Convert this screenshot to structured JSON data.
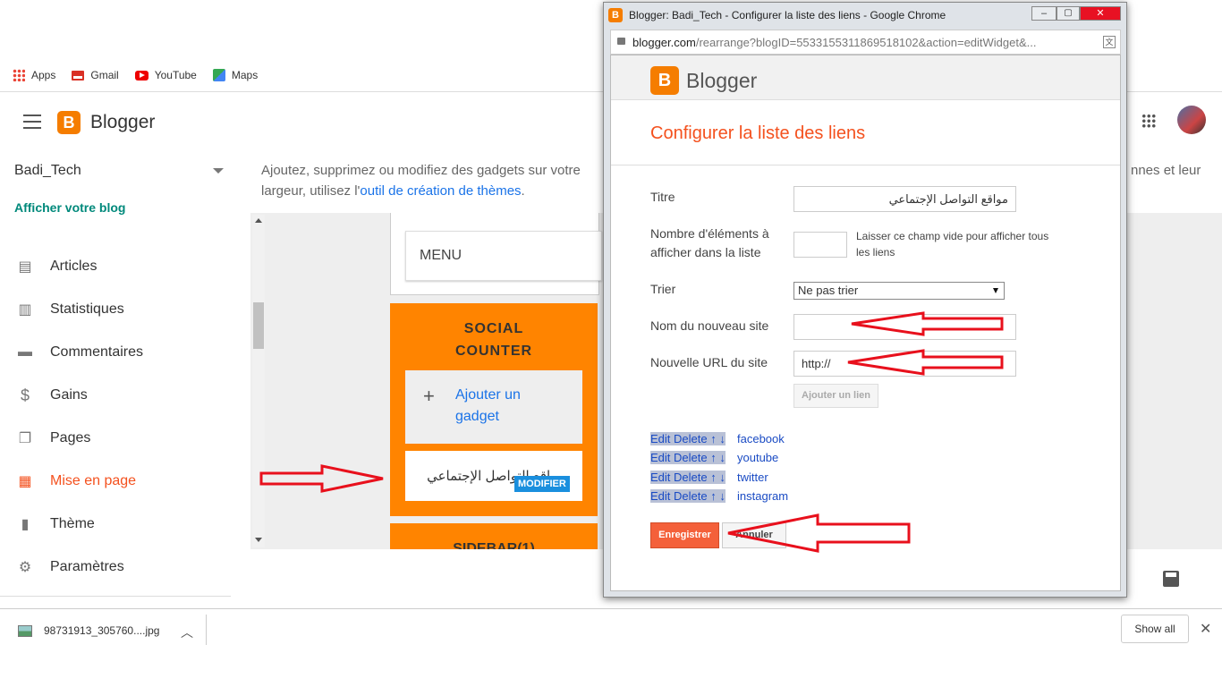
{
  "bookmarks": [
    {
      "label": "Apps",
      "icon": "apps-grid-icon"
    },
    {
      "label": "Gmail",
      "icon": "gmail-icon"
    },
    {
      "label": "YouTube",
      "icon": "youtube-icon"
    },
    {
      "label": "Maps",
      "icon": "maps-icon"
    }
  ],
  "blogger_header": {
    "brand": "Blogger"
  },
  "sidebar": {
    "blog_name": "Badi_Tech",
    "view_blog": "Afficher votre blog",
    "items": [
      {
        "label": "Articles",
        "icon": "articles-icon"
      },
      {
        "label": "Statistiques",
        "icon": "stats-icon"
      },
      {
        "label": "Commentaires",
        "icon": "comments-icon"
      },
      {
        "label": "Gains",
        "icon": "dollar-icon"
      },
      {
        "label": "Pages",
        "icon": "pages-icon"
      },
      {
        "label": "Mise en page",
        "icon": "layout-icon",
        "active": true
      },
      {
        "label": "Thème",
        "icon": "theme-icon"
      },
      {
        "label": "Paramètres",
        "icon": "settings-icon"
      }
    ]
  },
  "main": {
    "desc_prefix": "Ajoutez, supprimez ou modifiez des gadgets sur votre",
    "desc_right": "nnes et leur",
    "desc_line2_prefix": "largeur, utilisez l'",
    "desc_link": "outil de création de thèmes",
    "desc_line2_suffix": ".",
    "menu_label": "MENU",
    "social_title_1": "SOCIAL",
    "social_title_2": "COUNTER",
    "add_gadget_1": "Ajouter un",
    "add_gadget_2": "gadget",
    "gadget_name": "مواقع التواصل الإجتماعي",
    "modify_label": "MODIFIER",
    "sidebar_section": "SIDEBAR(1)"
  },
  "popup": {
    "window_title": "Blogger: Badi_Tech - Configurer la liste des liens - Google Chrome",
    "url_host": "blogger.com",
    "url_path": "/rearrange?blogID=5533155311869518102&action=editWidget&...",
    "brand": "Blogger",
    "heading": "Configurer la liste des liens",
    "form": {
      "titre_label": "Titre",
      "titre_value": "مواقع التواصل الإجتماعي",
      "count_label_1": "Nombre d'éléments à",
      "count_label_2": "afficher dans la liste",
      "count_hint_1": "Laisser ce champ vide pour afficher tous",
      "count_hint_2": "les liens",
      "sort_label": "Trier",
      "sort_value": "Ne pas trier",
      "site_name_label": "Nom du nouveau site",
      "site_url_label": "Nouvelle URL du site",
      "site_url_value": "http://",
      "add_link_button": "Ajouter un lien"
    },
    "links": [
      {
        "actions": "Edit Delete ↑ ↓",
        "name": "facebook"
      },
      {
        "actions": "Edit Delete ↑ ↓",
        "name": "youtube"
      },
      {
        "actions": "Edit Delete ↑ ↓",
        "name": "twitter"
      },
      {
        "actions": "Edit Delete ↑ ↓",
        "name": "instagram"
      }
    ],
    "save_button": "Enregistrer",
    "cancel_button": "Annuler"
  },
  "download_bar": {
    "file_name": "98731913_305760....jpg",
    "show_all": "Show all"
  },
  "colors": {
    "accent": "#f57d00",
    "blogger_orange": "#f4511e",
    "annotation_red": "#e8101c",
    "link_blue": "#1a4bc4"
  }
}
